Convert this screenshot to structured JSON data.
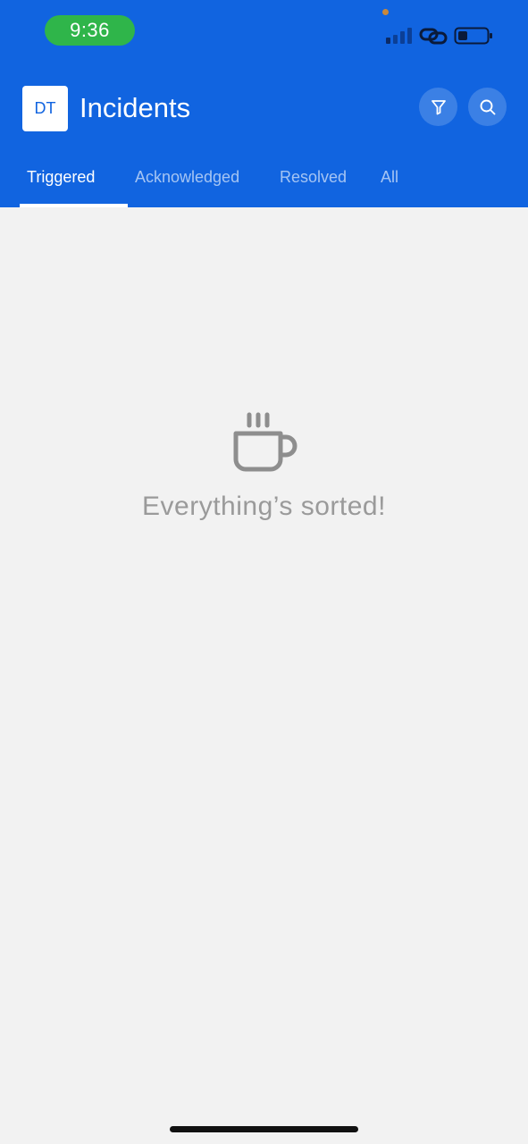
{
  "status_bar": {
    "time": "9:36"
  },
  "header": {
    "avatar_initials": "DT",
    "title": "Incidents",
    "background_color": "#1164e0"
  },
  "actions": {
    "filter_icon": "filter-icon",
    "search_icon": "search-icon"
  },
  "tabs": [
    {
      "label": "Triggered",
      "active": true
    },
    {
      "label": "Acknowledged",
      "active": false
    },
    {
      "label": "Resolved",
      "active": false
    },
    {
      "label": "All",
      "active": false
    }
  ],
  "empty_state": {
    "icon": "coffee-cup-icon",
    "message": "Everything’s sorted!"
  }
}
